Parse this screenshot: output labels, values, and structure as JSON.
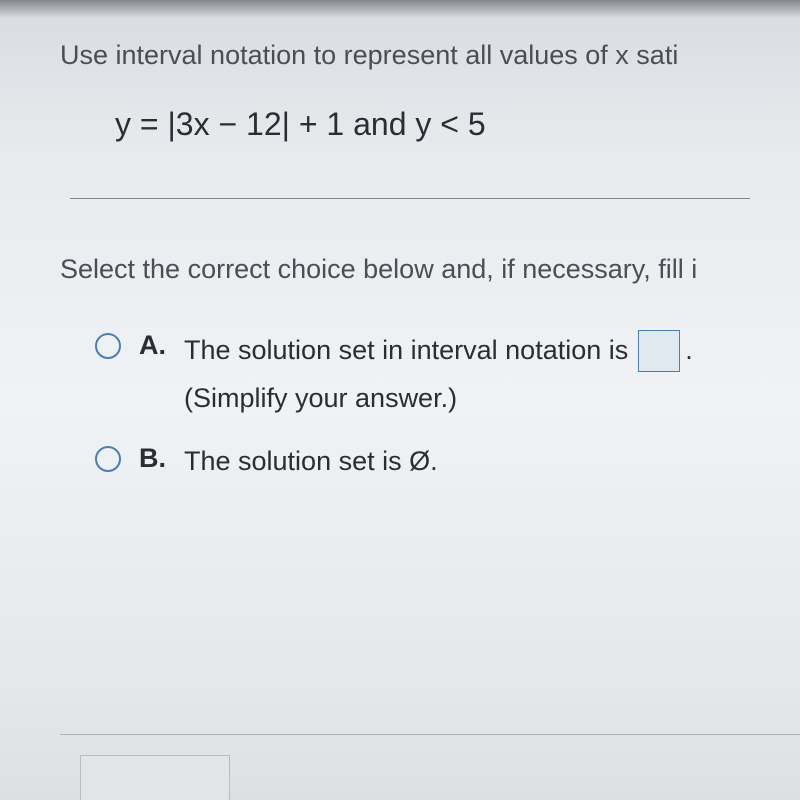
{
  "question": {
    "prompt": "Use interval notation to represent all values of x sati",
    "equation": "y = |3x − 12| + 1 and y < 5"
  },
  "instruction": "Select the correct choice below and, if necessary, fill i",
  "choices": {
    "a": {
      "label": "A.",
      "text": "The solution set in interval notation is",
      "sub": "(Simplify your answer.)"
    },
    "b": {
      "label": "B.",
      "text": "The solution set is Ø."
    }
  }
}
